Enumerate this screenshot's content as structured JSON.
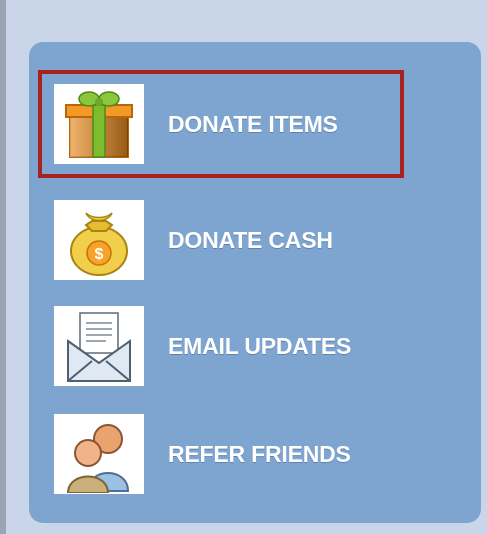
{
  "menu": {
    "items": [
      {
        "label": "DONATE ITEMS",
        "icon": "gift-icon",
        "selected": true
      },
      {
        "label": "DONATE CASH",
        "icon": "money-bag-icon",
        "selected": false
      },
      {
        "label": "EMAIL UPDATES",
        "icon": "envelope-icon",
        "selected": false
      },
      {
        "label": "REFER FRIENDS",
        "icon": "people-icon",
        "selected": false
      }
    ]
  },
  "colors": {
    "frame_background": "#c9d6ea",
    "panel_background": "#7ea4d0",
    "selection_border": "#a8231f",
    "label_text": "#ffffff"
  }
}
